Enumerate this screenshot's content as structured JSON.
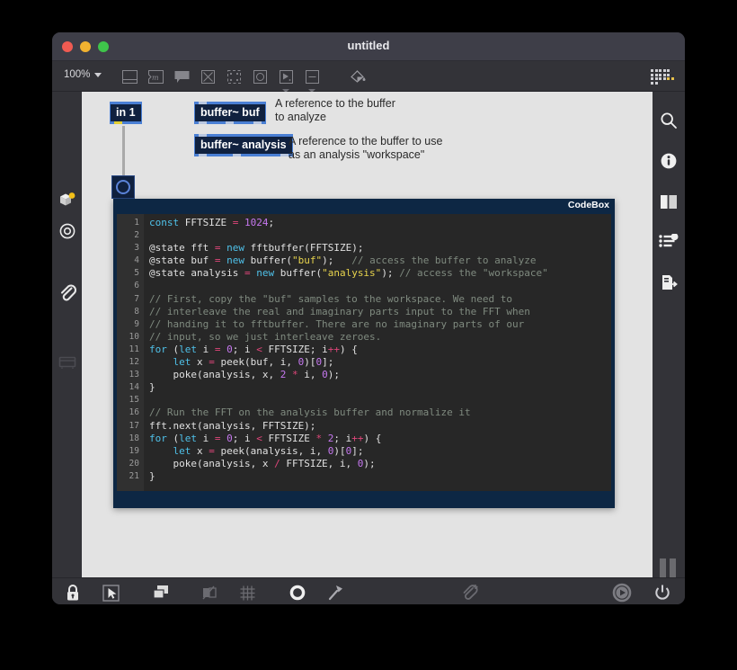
{
  "window": {
    "title": "untitled",
    "traffic_lights": [
      "close-button",
      "minimize-button",
      "maximize-button"
    ]
  },
  "toolbar": {
    "zoom_level": "100%",
    "icons": [
      {
        "name": "subpatcher-icon",
        "glyph": "window-split"
      },
      {
        "name": "message-box-icon",
        "glyph": "message"
      },
      {
        "name": "comment-icon",
        "glyph": "speech-bubble"
      },
      {
        "name": "toggle-icon",
        "glyph": "x-box"
      },
      {
        "name": "button-icon",
        "glyph": "dotted-box"
      },
      {
        "name": "dial-icon",
        "glyph": "circle-box"
      },
      {
        "name": "playback-icon",
        "glyph": "play-box"
      },
      {
        "name": "slider-icon",
        "glyph": "dash-box"
      },
      {
        "name": "paint-bucket-icon",
        "glyph": "bucket"
      }
    ],
    "grid_icon": "dot-matrix-icon"
  },
  "left_sidebar": {
    "items": [
      {
        "name": "sidebar-packages-icon",
        "label": "packages"
      },
      {
        "name": "sidebar-snapshot-icon",
        "label": "snapshot"
      },
      {
        "name": "sidebar-attachments-icon",
        "label": "attachments"
      },
      {
        "name": "sidebar-console-icon",
        "label": "console"
      }
    ]
  },
  "right_sidebar": {
    "items": [
      {
        "name": "search-icon",
        "label": "Search"
      },
      {
        "name": "info-icon",
        "label": "Info"
      },
      {
        "name": "reference-icon",
        "label": "Reference"
      },
      {
        "name": "parameters-icon",
        "label": "Parameters"
      },
      {
        "name": "export-icon",
        "label": "Export"
      }
    ],
    "meter": {
      "name": "level-meter",
      "value": 22
    }
  },
  "bottom_bar": {
    "left_icons": [
      {
        "name": "lock-icon",
        "label": "Lock patcher"
      },
      {
        "name": "edit-cursor-icon",
        "label": "Edit mode"
      },
      {
        "name": "presentation-icon",
        "label": "Presentation mode"
      },
      {
        "name": "hide-on-lock-icon",
        "label": "Hide on lock"
      },
      {
        "name": "grid-snap-icon",
        "label": "Snap to grid"
      },
      {
        "name": "distribute-icon",
        "label": "Distribute"
      },
      {
        "name": "pin-icon",
        "label": "Pin"
      },
      {
        "name": "add-attachment-icon",
        "label": "Add attachment"
      }
    ],
    "right_icons": [
      {
        "name": "audio-play-icon",
        "label": "Start audio"
      },
      {
        "name": "power-icon",
        "label": "Power"
      }
    ]
  },
  "patcher": {
    "objects": [
      {
        "name": "object-in-1",
        "text": "in 1"
      },
      {
        "name": "object-bang",
        "text": ""
      },
      {
        "name": "object-buffer-buf",
        "text": "buffer~ buf"
      },
      {
        "name": "object-buffer-analysis",
        "text": "buffer~ analysis"
      }
    ],
    "comments": [
      {
        "name": "comment-buffer-buf",
        "text": "A reference to the buffer\nto analyze"
      },
      {
        "name": "comment-buffer-analysis",
        "text": "A reference to the buffer to use\nas an analysis \"workspace\""
      }
    ]
  },
  "codebox": {
    "title": "CodeBox",
    "lines": [
      {
        "n": "1",
        "tokens": [
          [
            "tk-kw",
            "const"
          ],
          [
            "tk-pl",
            " FFTSIZE "
          ],
          [
            "tk-op",
            "="
          ],
          [
            "tk-pl",
            " "
          ],
          [
            "tk-num",
            "1024"
          ],
          [
            "tk-pl",
            ";"
          ]
        ]
      },
      {
        "n": "2",
        "tokens": [
          [
            "tk-pl",
            ""
          ]
        ]
      },
      {
        "n": "3",
        "tokens": [
          [
            "tk-at",
            "@state fft "
          ],
          [
            "tk-op",
            "="
          ],
          [
            "tk-pl",
            " "
          ],
          [
            "tk-kw",
            "new"
          ],
          [
            "tk-pl",
            " fftbuffer(FFTSIZE);"
          ]
        ]
      },
      {
        "n": "4",
        "tokens": [
          [
            "tk-at",
            "@state buf "
          ],
          [
            "tk-op",
            "="
          ],
          [
            "tk-pl",
            " "
          ],
          [
            "tk-kw",
            "new"
          ],
          [
            "tk-pl",
            " buffer("
          ],
          [
            "tk-str",
            "\"buf\""
          ],
          [
            "tk-pl",
            ");   "
          ],
          [
            "tk-cm",
            "// access the buffer to analyze"
          ]
        ]
      },
      {
        "n": "5",
        "tokens": [
          [
            "tk-at",
            "@state analysis "
          ],
          [
            "tk-op",
            "="
          ],
          [
            "tk-pl",
            " "
          ],
          [
            "tk-kw",
            "new"
          ],
          [
            "tk-pl",
            " buffer("
          ],
          [
            "tk-str",
            "\"analysis\""
          ],
          [
            "tk-pl",
            "); "
          ],
          [
            "tk-cm",
            "// access the \"workspace\""
          ]
        ]
      },
      {
        "n": "6",
        "tokens": [
          [
            "tk-pl",
            ""
          ]
        ]
      },
      {
        "n": "7",
        "tokens": [
          [
            "tk-cm",
            "// First, copy the \"buf\" samples to the workspace. We need to"
          ]
        ]
      },
      {
        "n": "8",
        "tokens": [
          [
            "tk-cm",
            "// interleave the real and imaginary parts input to the FFT when"
          ]
        ]
      },
      {
        "n": "9",
        "tokens": [
          [
            "tk-cm",
            "// handing it to fftbuffer. There are no imaginary parts of our"
          ]
        ]
      },
      {
        "n": "10",
        "tokens": [
          [
            "tk-cm",
            "// input, so we just interleave zeroes."
          ]
        ]
      },
      {
        "n": "11",
        "tokens": [
          [
            "tk-kw",
            "for"
          ],
          [
            "tk-pl",
            " ("
          ],
          [
            "tk-kw",
            "let"
          ],
          [
            "tk-pl",
            " i "
          ],
          [
            "tk-op",
            "="
          ],
          [
            "tk-pl",
            " "
          ],
          [
            "tk-num",
            "0"
          ],
          [
            "tk-pl",
            "; i "
          ],
          [
            "tk-op",
            "<"
          ],
          [
            "tk-pl",
            " FFTSIZE; i"
          ],
          [
            "tk-op",
            "++"
          ],
          [
            "tk-pl",
            ") {"
          ]
        ]
      },
      {
        "n": "12",
        "tokens": [
          [
            "tk-pl",
            "    "
          ],
          [
            "tk-kw",
            "let"
          ],
          [
            "tk-pl",
            " x "
          ],
          [
            "tk-op",
            "="
          ],
          [
            "tk-pl",
            " peek(buf, i, "
          ],
          [
            "tk-num",
            "0"
          ],
          [
            "tk-pl",
            ")["
          ],
          [
            "tk-num",
            "0"
          ],
          [
            "tk-pl",
            "];"
          ]
        ]
      },
      {
        "n": "13",
        "tokens": [
          [
            "tk-pl",
            "    poke(analysis, x, "
          ],
          [
            "tk-num",
            "2"
          ],
          [
            "tk-pl",
            " "
          ],
          [
            "tk-op",
            "*"
          ],
          [
            "tk-pl",
            " i, "
          ],
          [
            "tk-num",
            "0"
          ],
          [
            "tk-pl",
            ");"
          ]
        ]
      },
      {
        "n": "14",
        "tokens": [
          [
            "tk-pl",
            "}"
          ]
        ]
      },
      {
        "n": "15",
        "tokens": [
          [
            "tk-pl",
            ""
          ]
        ]
      },
      {
        "n": "16",
        "tokens": [
          [
            "tk-cm",
            "// Run the FFT on the analysis buffer and normalize it"
          ]
        ]
      },
      {
        "n": "17",
        "tokens": [
          [
            "tk-pl",
            "fft.next(analysis, FFTSIZE);"
          ]
        ]
      },
      {
        "n": "18",
        "tokens": [
          [
            "tk-kw",
            "for"
          ],
          [
            "tk-pl",
            " ("
          ],
          [
            "tk-kw",
            "let"
          ],
          [
            "tk-pl",
            " i "
          ],
          [
            "tk-op",
            "="
          ],
          [
            "tk-pl",
            " "
          ],
          [
            "tk-num",
            "0"
          ],
          [
            "tk-pl",
            "; i "
          ],
          [
            "tk-op",
            "<"
          ],
          [
            "tk-pl",
            " FFTSIZE "
          ],
          [
            "tk-op",
            "*"
          ],
          [
            "tk-pl",
            " "
          ],
          [
            "tk-num",
            "2"
          ],
          [
            "tk-pl",
            "; i"
          ],
          [
            "tk-op",
            "++"
          ],
          [
            "tk-pl",
            ") {"
          ]
        ]
      },
      {
        "n": "19",
        "tokens": [
          [
            "tk-pl",
            "    "
          ],
          [
            "tk-kw",
            "let"
          ],
          [
            "tk-pl",
            " x "
          ],
          [
            "tk-op",
            "="
          ],
          [
            "tk-pl",
            " peek(analysis, i, "
          ],
          [
            "tk-num",
            "0"
          ],
          [
            "tk-pl",
            ")["
          ],
          [
            "tk-num",
            "0"
          ],
          [
            "tk-pl",
            "];"
          ]
        ]
      },
      {
        "n": "20",
        "tokens": [
          [
            "tk-pl",
            "    poke(analysis, x "
          ],
          [
            "tk-op",
            "/"
          ],
          [
            "tk-pl",
            " FFTSIZE, i, "
          ],
          [
            "tk-num",
            "0"
          ],
          [
            "tk-pl",
            ");"
          ]
        ]
      },
      {
        "n": "21",
        "tokens": [
          [
            "tk-pl",
            "}"
          ]
        ]
      }
    ]
  },
  "colors": {
    "window_chrome": "#3a3a42",
    "canvas": "#e3e3e3",
    "object_fill": "#10213f",
    "object_selected_border": "#4a7fd4",
    "codebox_frame": "#0d2744",
    "code_bg": "#272727",
    "accent_yellow": "#e7c14b"
  }
}
